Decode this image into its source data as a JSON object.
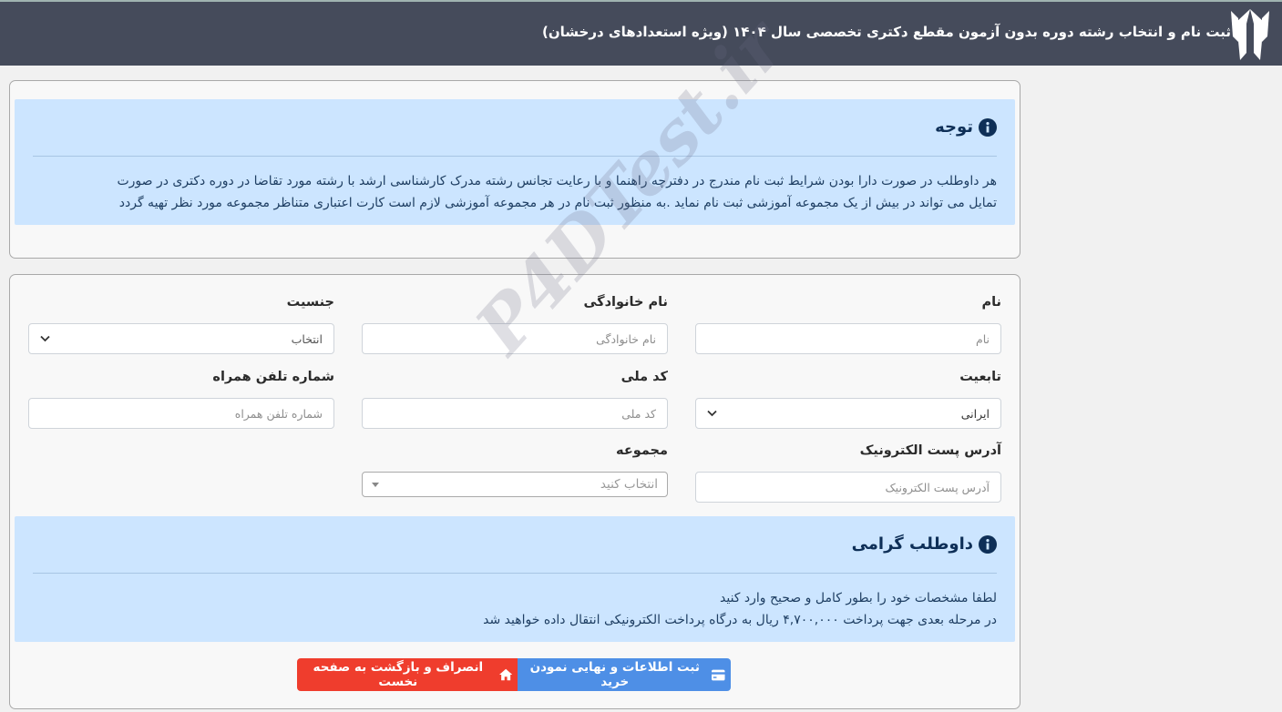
{
  "header": {
    "title": "ثبت نام و انتخاب رشته دوره بدون آزمون مقطع دکتری تخصصی سال ۱۴۰۴ (ویژه استعدادهای درخشان)",
    "logo_icon": "university-logo-icon"
  },
  "notice": {
    "heading": "توجه",
    "body_line1": "هر داوطلب در صورت دارا بودن شرایط ثبت نام مندرج در دفترچه راهنما و با رعایت تجانس رشته مدرک کارشناسی ارشد با رشته مورد تقاضا در دوره دکتری در صورت",
    "body_line2": "تمایل می تواند در بیش از یک مجموعه آموزشی ثبت نام نماید .به منظور ثبت نام در هر مجموعه آموزشی لازم است کارت اعتباری متناظر مجموعه مورد نظر تهیه گردد"
  },
  "form": {
    "first_name": {
      "label": "نام",
      "placeholder": "نام"
    },
    "last_name": {
      "label": "نام خانوادگی",
      "placeholder": "نام خانوادگی"
    },
    "gender": {
      "label": "جنسیت",
      "selected": "انتخاب"
    },
    "nationality": {
      "label": "تابعیت",
      "selected": "ایرانی"
    },
    "national_code": {
      "label": "کد ملی",
      "placeholder": "کد ملی"
    },
    "mobile": {
      "label": "شماره تلفن همراه",
      "placeholder": "شماره تلفن همراه"
    },
    "email": {
      "label": "آدرس پست الکترونیک",
      "placeholder": "آدرس پست الکترونیک"
    },
    "group": {
      "label": "مجموعه",
      "placeholder": "انتخاب کنید"
    }
  },
  "candidate_notice": {
    "heading": "داوطلب گرامی",
    "line1": "لطفا مشخصات خود را بطور کامل و صحیح وارد کنید",
    "line2": "در مرحله بعدی جهت پرداخت ۴,۷۰۰,۰۰۰ ریال به درگاه پرداخت الکترونیکی انتقال داده خواهید شد"
  },
  "actions": {
    "submit_label": "ثبت اطلاعات و نهایی نمودن خرید",
    "cancel_label": "انصراف و بازگشت به صفحه نخست"
  },
  "watermark": "P4DTest.ir",
  "colors": {
    "header_bg": "#454b5b",
    "alert_bg": "#cce5ff",
    "submit_btn": "#4e8fe6",
    "cancel_btn": "#ef3d2d"
  }
}
